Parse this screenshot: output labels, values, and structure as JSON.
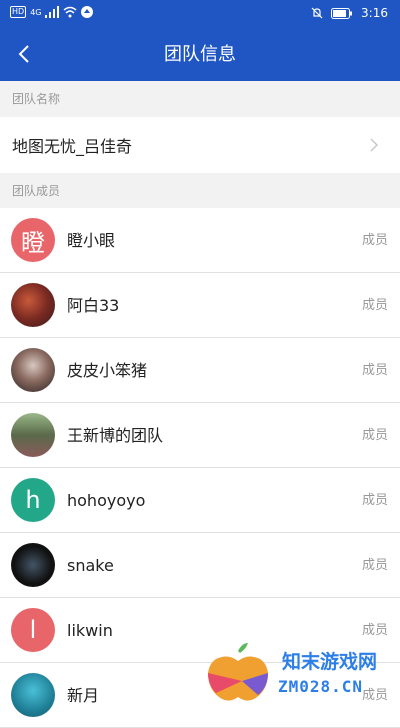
{
  "status_bar": {
    "hd_label": "HD",
    "network_label": "4G",
    "time": "3:16"
  },
  "header": {
    "title": "团队信息"
  },
  "sections": {
    "team_name_label": "团队名称",
    "team_members_label": "团队成员"
  },
  "team": {
    "name": "地图无忧_吕佳奇"
  },
  "members": [
    {
      "name": "瞪小眼",
      "role": "成员",
      "avatar_letter": "瞪",
      "avatar_color": "#e8666a"
    },
    {
      "name": "阿白33",
      "role": "成员",
      "avatar_letter": "",
      "avatar_color": "#7a3a2e"
    },
    {
      "name": "皮皮小笨猪",
      "role": "成员",
      "avatar_letter": "",
      "avatar_color": "#6a5a55"
    },
    {
      "name": "王新博的团队",
      "role": "成员",
      "avatar_letter": "",
      "avatar_color": "#6f8a5a"
    },
    {
      "name": "hohoyoyo",
      "role": "成员",
      "avatar_letter": "h",
      "avatar_color": "#22a888"
    },
    {
      "name": "snake",
      "role": "成员",
      "avatar_letter": "",
      "avatar_color": "#111111"
    },
    {
      "name": "likwin",
      "role": "成员",
      "avatar_letter": "l",
      "avatar_color": "#e8666a"
    },
    {
      "name": "新月",
      "role": "成员",
      "avatar_letter": "",
      "avatar_color": "#1f8fa6"
    }
  ],
  "watermark": {
    "line1": "知末游戏网",
    "line2": "ZM028.CN"
  },
  "colors": {
    "primary": "#1f56c4",
    "muted_text": "#999999",
    "background": "#f2f2f2"
  }
}
